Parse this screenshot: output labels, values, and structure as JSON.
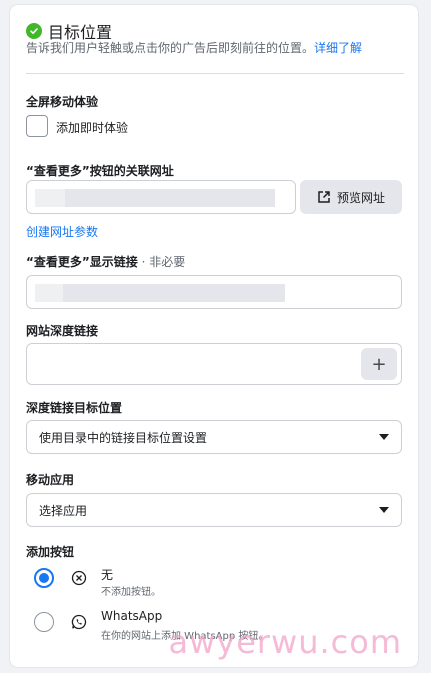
{
  "section": {
    "title": "目标位置",
    "description": "告诉我们用户轻触或点击你的广告后即刻前往的位置。",
    "learn_more": "详细了解"
  },
  "fullscreen": {
    "label": "全屏移动体验",
    "checkbox_label": "添加即时体验",
    "checked": false
  },
  "see_more_url": {
    "label": "“查看更多”按钮的关联网址",
    "value": "",
    "preview_button": "预览网址",
    "create_params_link": "创建网址参数"
  },
  "display_link": {
    "label": "“查看更多”显示链接",
    "optional": " · 非必要",
    "value": ""
  },
  "deep_link": {
    "label": "网站深度链接",
    "value": "",
    "add_button": "+"
  },
  "deep_link_target": {
    "label": "深度链接目标位置",
    "selected": "使用目录中的链接目标位置设置"
  },
  "mobile_app": {
    "label": "移动应用",
    "selected": "选择应用"
  },
  "add_button": {
    "label": "添加按钮",
    "options": [
      {
        "title": "无",
        "description": "不添加按钮。",
        "selected": true,
        "icon": "circle-x-icon"
      },
      {
        "title": "WhatsApp",
        "description": "在你的网站上添加 WhatsApp 按钮。",
        "selected": false,
        "icon": "whatsapp-icon"
      }
    ]
  },
  "watermark": "awyerwu.com",
  "colors": {
    "accent": "#1877f2",
    "success": "#42b72a"
  }
}
